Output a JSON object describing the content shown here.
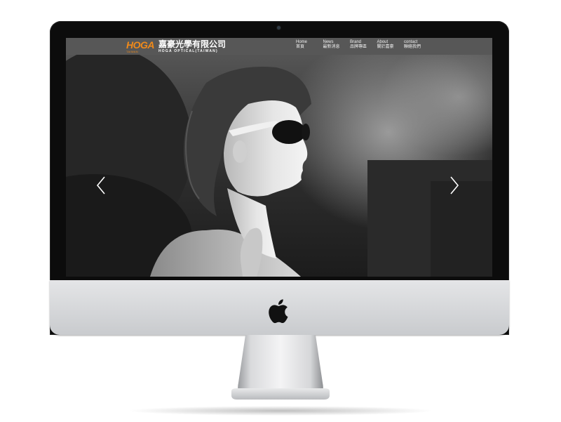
{
  "site": {
    "logo_mark": "HOGA",
    "logo_sub": "TAIWAN",
    "logo_cn": "嘉豪光學有限公司",
    "logo_en": "HOGA OPTICAL(TAIWAN)"
  },
  "nav": {
    "items": [
      {
        "en": "Home",
        "zh": "首頁"
      },
      {
        "en": "News",
        "zh": "最新消息"
      },
      {
        "en": "Brand",
        "zh": "品牌專區"
      },
      {
        "en": "About",
        "zh": "關於嘉豪"
      },
      {
        "en": "contact",
        "zh": "聯絡我們"
      }
    ]
  },
  "hero": {
    "prev_icon": "chevron-left-icon",
    "next_icon": "chevron-right-icon"
  },
  "colors": {
    "brand_orange": "#f08a1a",
    "navbar": "#5a5a5a",
    "bezel": "#0c0c0c",
    "chin": "#d7d8da"
  }
}
